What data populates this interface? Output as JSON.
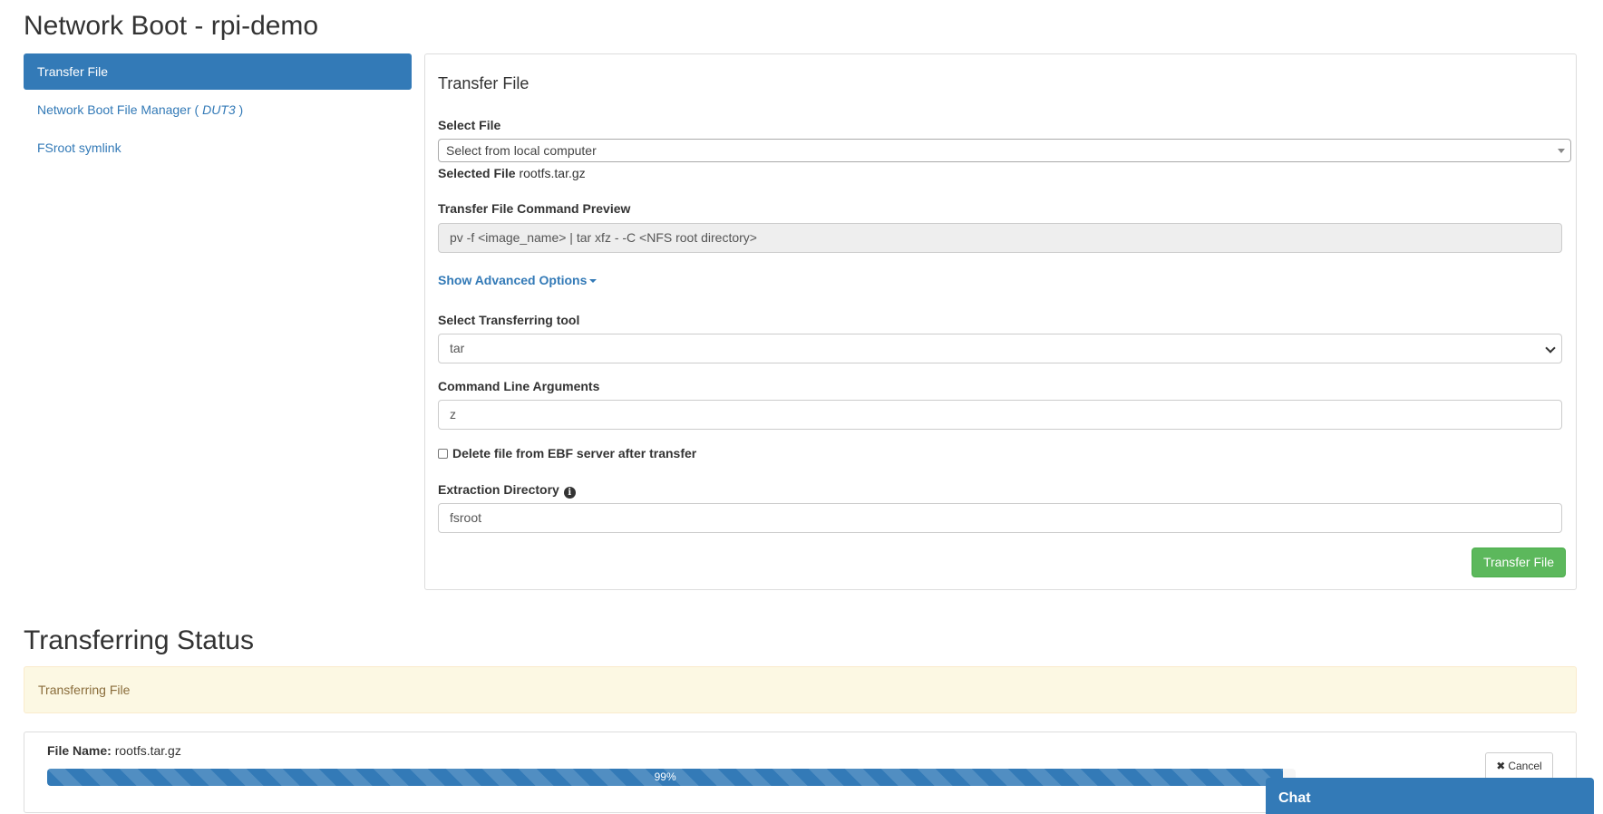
{
  "page": {
    "title": "Network Boot - rpi-demo"
  },
  "sidebar": {
    "items": [
      {
        "label": "Transfer File",
        "active": true
      },
      {
        "label": "Network Boot File Manager ( ",
        "em": "DUT3",
        "suffix": " )"
      },
      {
        "label": "FSroot symlink"
      }
    ]
  },
  "panel": {
    "title": "Transfer File",
    "select_file_label": "Select File",
    "select_file_value": "Select from local computer",
    "selected_file_label": "Selected File",
    "selected_file_value": "rootfs.tar.gz",
    "preview_label": "Transfer File Command Preview",
    "preview_value": "pv -f <image_name> | tar xfz - -C <NFS root directory>",
    "advanced_link": "Show Advanced Options",
    "tool_label": "Select Transferring tool",
    "tool_value": "tar",
    "args_label": "Command Line Arguments",
    "args_value": "z",
    "delete_label": "Delete file from EBF server after transfer",
    "delete_checked": false,
    "extract_label": "Extraction Directory",
    "extract_value": "fsroot",
    "submit_label": "Transfer File"
  },
  "status": {
    "title": "Transferring Status",
    "alert": "Transferring File",
    "file_name_label": "File Name:",
    "file_name_value": "rootfs.tar.gz",
    "progress_percent": 99,
    "progress_text": "99%",
    "cancel_label": "Cancel"
  },
  "chat": {
    "label": "Chat"
  },
  "colors": {
    "primary": "#337ab7",
    "success": "#5cb85c",
    "warning_bg": "#fcf8e3",
    "warning_text": "#8a6d3b"
  }
}
